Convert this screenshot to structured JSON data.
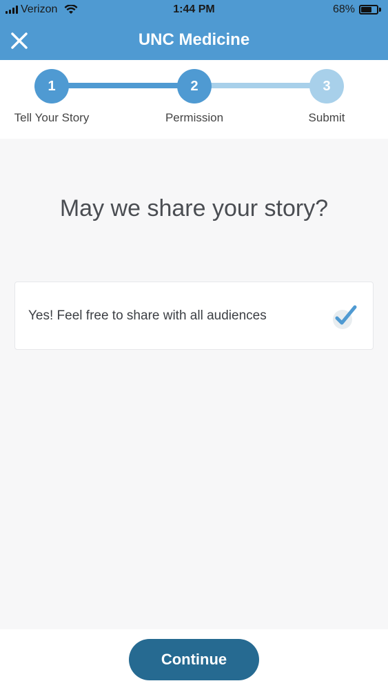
{
  "status_bar": {
    "carrier": "Verizon",
    "time": "1:44 PM",
    "battery_percent": "68%"
  },
  "nav": {
    "title": "UNC Medicine",
    "close_icon": "close-icon"
  },
  "stepper": {
    "steps": [
      {
        "number": "1",
        "label": "Tell Your Story",
        "state": "complete"
      },
      {
        "number": "2",
        "label": "Permission",
        "state": "current"
      },
      {
        "number": "3",
        "label": "Submit",
        "state": "pending"
      }
    ]
  },
  "main": {
    "question": "May we share your story?",
    "option": {
      "label": "Yes! Feel free to share with all audiences",
      "checked": true
    }
  },
  "footer": {
    "continue_label": "Continue"
  },
  "colors": {
    "primary": "#4f9ad2",
    "primary_light": "#a8d0ea",
    "button": "#266a91",
    "background": "#f7f7f8"
  }
}
